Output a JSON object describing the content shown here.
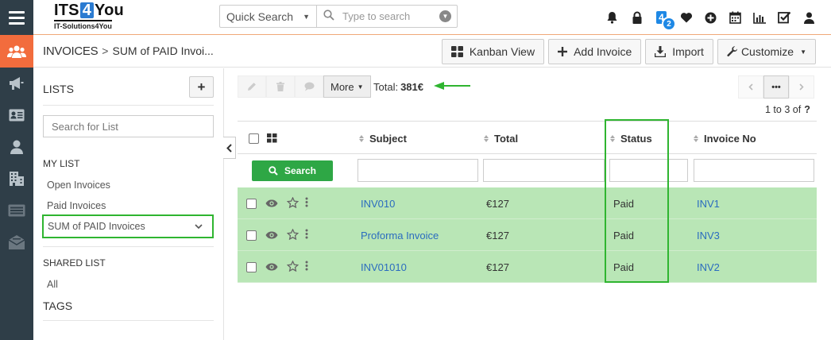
{
  "brand": {
    "prefix": "ITS",
    "highlight": "4",
    "suffix": "You",
    "tagline": "IT-Solutions4You"
  },
  "quick_search": {
    "select_label": "Quick Search",
    "placeholder": "Type to search"
  },
  "top_icons": [
    "bell-icon",
    "lock-icon",
    "its4you-icon",
    "heart-icon",
    "plus-circle-icon",
    "calendar-icon",
    "bar-chart-icon",
    "checkbox-icon",
    "user-icon"
  ],
  "notification_badge": "2",
  "its4you_icon_label": "4",
  "breadcrumb": {
    "module": "INVOICES",
    "separator": ">",
    "current": "SUM of PAID Invoi..."
  },
  "toolbar": {
    "kanban": "Kanban View",
    "add": "Add Invoice",
    "import": "Import",
    "customize": "Customize"
  },
  "sidebar": {
    "lists_title": "LISTS",
    "add_symbol": "+",
    "search_placeholder": "Search for List",
    "my_list_title": "MY LIST",
    "my_list": [
      "Open Invoices",
      "Paid Invoices",
      "SUM of PAID Invoices"
    ],
    "shared_list_title": "SHARED LIST",
    "shared_list": [
      "All"
    ],
    "tags_title": "TAGS"
  },
  "actions": {
    "more": "More",
    "total_label": "Total:",
    "total_value": "381€"
  },
  "pager": {
    "info": "1 to 3  of",
    "unknown": "?",
    "ellipsis": "•••"
  },
  "table": {
    "columns": [
      "Subject",
      "Total",
      "Status",
      "Invoice No"
    ],
    "search_button": "Search",
    "rows": [
      {
        "subject": "INV010",
        "total": "€127",
        "status": "Paid",
        "invoice_no": "INV1"
      },
      {
        "subject": "Proforma Invoice",
        "total": "€127",
        "status": "Paid",
        "invoice_no": "INV3"
      },
      {
        "subject": "INV01010",
        "total": "€127",
        "status": "Paid",
        "invoice_no": "INV2"
      }
    ]
  },
  "colors": {
    "accent_orange": "#f26c3d",
    "rail": "#2f3e48",
    "row_highlight": "#b9e6b6",
    "annotation_green": "#2fb530",
    "link_blue": "#2b6cbf",
    "search_green": "#2ea745"
  }
}
